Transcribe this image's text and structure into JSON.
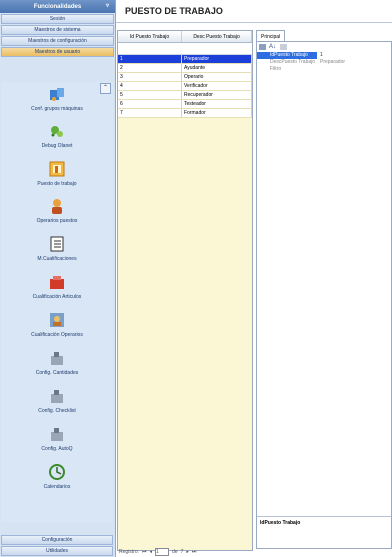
{
  "sidebar": {
    "header": "Funcionalidades",
    "buttons": [
      "Sesión",
      "Maestros de sistema",
      "Maestros de configuración",
      "Maestros de usuario"
    ],
    "items": [
      {
        "label": "Conf. grupos máquinas",
        "icon": "machine-group-icon"
      },
      {
        "label": "Debug Olanet",
        "icon": "debug-icon"
      },
      {
        "label": "Puesto de trabajo",
        "icon": "workstation-icon"
      },
      {
        "label": "Operarios puestos",
        "icon": "operator-icon"
      },
      {
        "label": "M.Cualificaciones",
        "icon": "qualifications-list-icon"
      },
      {
        "label": "Cualificación Articulos",
        "icon": "article-qualification-icon"
      },
      {
        "label": "Cualificación Operarios",
        "icon": "operator-qualification-icon"
      },
      {
        "label": "Config. Cantidades",
        "icon": "config-quantities-icon"
      },
      {
        "label": "Config. Checklist",
        "icon": "config-checklist-icon"
      },
      {
        "label": "Config. AutoQ",
        "icon": "config-autoq-icon"
      },
      {
        "label": "Calendarios",
        "icon": "calendar-icon"
      }
    ],
    "bottom": [
      "Configuración",
      "Utilidades"
    ]
  },
  "main": {
    "title": "PUESTO DE TRABAJO",
    "grid": {
      "columns": [
        "Id Puesto Trabajo",
        "Desc Puesto Trabajo"
      ],
      "rows": [
        [
          "1",
          "Preparador"
        ],
        [
          "2",
          "Ayudante"
        ],
        [
          "3",
          "Operario"
        ],
        [
          "4",
          "Verificador"
        ],
        [
          "5",
          "Recuperador"
        ],
        [
          "6",
          "Testeador"
        ],
        [
          "7",
          "Formador"
        ]
      ],
      "selected_index": 0
    },
    "pager": {
      "label": "Registro:",
      "current": "1",
      "of": "de",
      "total": "7"
    },
    "tab": "Principal",
    "properties": [
      {
        "key": "IdPuesto Trabajo",
        "value": "1"
      },
      {
        "key": "DescPuesto Trabajo",
        "value": "Preparador"
      },
      {
        "key": "Filtro",
        "value": ""
      }
    ],
    "description_title": "IdPuesto Trabajo"
  }
}
